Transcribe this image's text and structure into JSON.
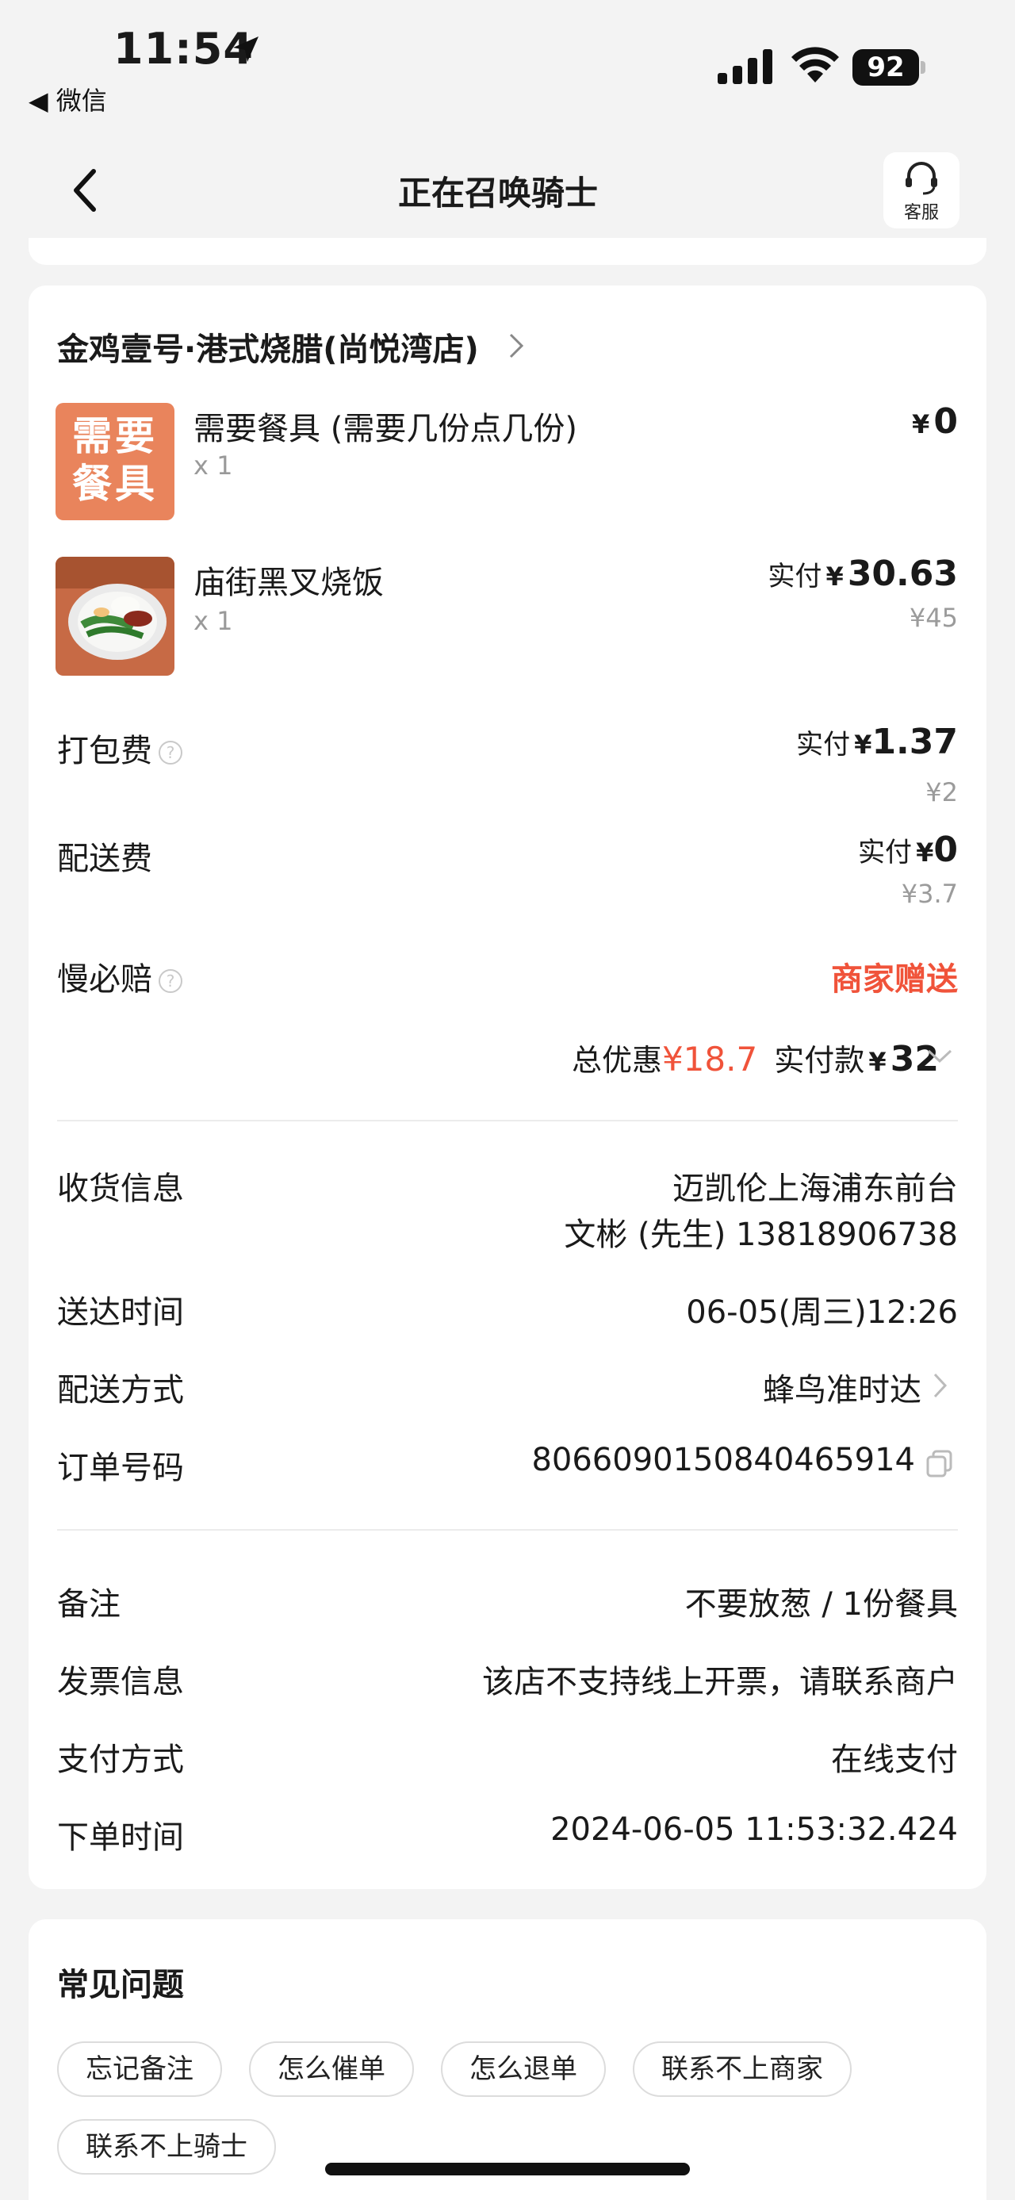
{
  "status_bar": {
    "time": "11:54",
    "back_app": "◀ 微信",
    "battery": "92"
  },
  "nav": {
    "title": "正在召唤骑士",
    "service_label": "客服"
  },
  "order": {
    "shop_name": "金鸡壹号·港式烧腊(尚悦湾店)",
    "items": [
      {
        "thumb_text_line1": "需要",
        "thumb_text_line2": "餐具",
        "name": "需要餐具 (需要几份点几份)",
        "qty": "x 1",
        "yen": "¥",
        "price": "0"
      },
      {
        "name": "庙街黑叉烧饭",
        "qty": "x 1",
        "paid_label": "实付",
        "yen": "¥",
        "price": "30.63",
        "original": "¥45"
      }
    ],
    "fees": [
      {
        "label": "打包费",
        "paid_label": "实付",
        "yen": "¥",
        "price": "1.37",
        "original": "¥2"
      },
      {
        "label": "配送费",
        "paid_label": "实付",
        "yen": "¥",
        "price": "0",
        "original": "¥3.7"
      }
    ],
    "slow_comp": {
      "label": "慢必赔",
      "value": "商家赠送"
    },
    "summary": {
      "discount_label": "总优惠",
      "discount_value": "¥18.7",
      "paid_label": "实付款",
      "yen": "¥",
      "paid_value": "32"
    },
    "info": {
      "receiver_label": "收货信息",
      "receiver_addr": "迈凯伦上海浦东前台",
      "receiver_contact": "文彬 (先生) 13818906738",
      "delivery_time_label": "送达时间",
      "delivery_time": "06-05(周三)12:26",
      "delivery_method_label": "配送方式",
      "delivery_method": "蜂鸟准时达",
      "order_no_label": "订单号码",
      "order_no": "8066090150840465914"
    },
    "extra": {
      "remark_label": "备注",
      "remark": "不要放葱 / 1份餐具",
      "invoice_label": "发票信息",
      "invoice": "该店不支持线上开票，请联系商户",
      "payment_label": "支付方式",
      "payment": "在线支付",
      "order_time_label": "下单时间",
      "order_time": "2024-06-05 11:53:32.424"
    }
  },
  "faq": {
    "title": "常见问题",
    "chips": [
      "忘记备注",
      "怎么催单",
      "怎么退单",
      "联系不上商家",
      "联系不上骑士"
    ]
  },
  "colors": {
    "accent_red": "#f0533a",
    "background": "#f3f3f3",
    "thumb_orange": "#e9845c"
  }
}
